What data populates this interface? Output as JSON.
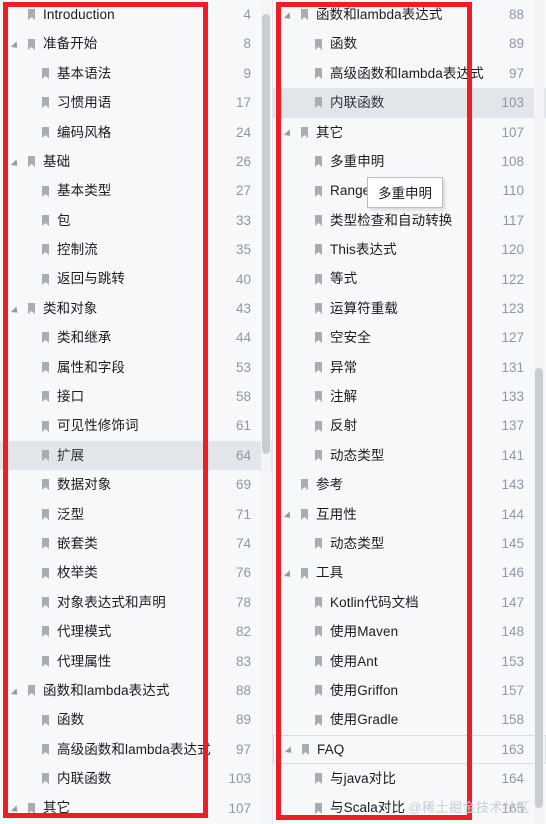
{
  "meta": {
    "watermark": "@稀土掘金技术社区",
    "accent_red": "#ee1c25",
    "selected_bg": "#e2e5ea",
    "page_number_color": "#8e96a8"
  },
  "tooltip": {
    "text": "多重申明"
  },
  "left_panel": {
    "items": [
      {
        "label": "Introduction",
        "page": "4",
        "level": 0,
        "expandable": false,
        "state": "normal"
      },
      {
        "label": "准备开始",
        "page": "8",
        "level": 0,
        "expandable": true,
        "state": "normal"
      },
      {
        "label": "基本语法",
        "page": "9",
        "level": 1,
        "expandable": false,
        "state": "normal"
      },
      {
        "label": "习惯用语",
        "page": "17",
        "level": 1,
        "expandable": false,
        "state": "normal"
      },
      {
        "label": "编码风格",
        "page": "24",
        "level": 1,
        "expandable": false,
        "state": "normal"
      },
      {
        "label": "基础",
        "page": "26",
        "level": 0,
        "expandable": true,
        "state": "normal"
      },
      {
        "label": "基本类型",
        "page": "27",
        "level": 1,
        "expandable": false,
        "state": "normal"
      },
      {
        "label": "包",
        "page": "33",
        "level": 1,
        "expandable": false,
        "state": "normal"
      },
      {
        "label": "控制流",
        "page": "35",
        "level": 1,
        "expandable": false,
        "state": "normal"
      },
      {
        "label": "返回与跳转",
        "page": "40",
        "level": 1,
        "expandable": false,
        "state": "normal"
      },
      {
        "label": "类和对象",
        "page": "43",
        "level": 0,
        "expandable": true,
        "state": "normal"
      },
      {
        "label": "类和继承",
        "page": "44",
        "level": 1,
        "expandable": false,
        "state": "normal"
      },
      {
        "label": "属性和字段",
        "page": "53",
        "level": 1,
        "expandable": false,
        "state": "normal"
      },
      {
        "label": "接口",
        "page": "58",
        "level": 1,
        "expandable": false,
        "state": "normal"
      },
      {
        "label": "可见性修饰词",
        "page": "61",
        "level": 1,
        "expandable": false,
        "state": "normal"
      },
      {
        "label": "扩展",
        "page": "64",
        "level": 1,
        "expandable": false,
        "state": "selected"
      },
      {
        "label": "数据对象",
        "page": "69",
        "level": 1,
        "expandable": false,
        "state": "normal"
      },
      {
        "label": "泛型",
        "page": "71",
        "level": 1,
        "expandable": false,
        "state": "normal"
      },
      {
        "label": "嵌套类",
        "page": "74",
        "level": 1,
        "expandable": false,
        "state": "normal"
      },
      {
        "label": "枚举类",
        "page": "76",
        "level": 1,
        "expandable": false,
        "state": "normal"
      },
      {
        "label": "对象表达式和声明",
        "page": "78",
        "level": 1,
        "expandable": false,
        "state": "normal"
      },
      {
        "label": "代理模式",
        "page": "82",
        "level": 1,
        "expandable": false,
        "state": "normal"
      },
      {
        "label": "代理属性",
        "page": "83",
        "level": 1,
        "expandable": false,
        "state": "normal"
      },
      {
        "label": "函数和lambda表达式",
        "page": "88",
        "level": 0,
        "expandable": true,
        "state": "normal"
      },
      {
        "label": "函数",
        "page": "89",
        "level": 1,
        "expandable": false,
        "state": "normal"
      },
      {
        "label": "高级函数和lambda表达式",
        "page": "97",
        "level": 1,
        "expandable": false,
        "state": "normal"
      },
      {
        "label": "内联函数",
        "page": "103",
        "level": 1,
        "expandable": false,
        "state": "normal"
      },
      {
        "label": "其它",
        "page": "107",
        "level": 0,
        "expandable": true,
        "state": "normal"
      }
    ]
  },
  "right_panel": {
    "items": [
      {
        "label": "函数和lambda表达式",
        "page": "88",
        "level": 0,
        "expandable": true,
        "state": "normal"
      },
      {
        "label": "函数",
        "page": "89",
        "level": 1,
        "expandable": false,
        "state": "normal"
      },
      {
        "label": "高级函数和lambda表达式",
        "page": "97",
        "level": 1,
        "expandable": false,
        "state": "normal"
      },
      {
        "label": "内联函数",
        "page": "103",
        "level": 1,
        "expandable": false,
        "state": "selected"
      },
      {
        "label": "其它",
        "page": "107",
        "level": 0,
        "expandable": true,
        "state": "normal"
      },
      {
        "label": "多重申明",
        "page": "108",
        "level": 1,
        "expandable": false,
        "state": "normal"
      },
      {
        "label": "Ranges",
        "page": "110",
        "level": 1,
        "expandable": false,
        "state": "normal"
      },
      {
        "label": "类型检查和自动转换",
        "page": "117",
        "level": 1,
        "expandable": false,
        "state": "normal"
      },
      {
        "label": "This表达式",
        "page": "120",
        "level": 1,
        "expandable": false,
        "state": "normal"
      },
      {
        "label": "等式",
        "page": "122",
        "level": 1,
        "expandable": false,
        "state": "normal"
      },
      {
        "label": "运算符重载",
        "page": "123",
        "level": 1,
        "expandable": false,
        "state": "normal"
      },
      {
        "label": "空安全",
        "page": "127",
        "level": 1,
        "expandable": false,
        "state": "normal"
      },
      {
        "label": "异常",
        "page": "131",
        "level": 1,
        "expandable": false,
        "state": "normal"
      },
      {
        "label": "注解",
        "page": "133",
        "level": 1,
        "expandable": false,
        "state": "normal"
      },
      {
        "label": "反射",
        "page": "137",
        "level": 1,
        "expandable": false,
        "state": "normal"
      },
      {
        "label": "动态类型",
        "page": "141",
        "level": 1,
        "expandable": false,
        "state": "normal"
      },
      {
        "label": "参考",
        "page": "143",
        "level": 0,
        "expandable": false,
        "state": "normal"
      },
      {
        "label": "互用性",
        "page": "144",
        "level": 0,
        "expandable": true,
        "state": "normal"
      },
      {
        "label": "动态类型",
        "page": "145",
        "level": 1,
        "expandable": false,
        "state": "normal"
      },
      {
        "label": "工具",
        "page": "146",
        "level": 0,
        "expandable": true,
        "state": "normal"
      },
      {
        "label": "Kotlin代码文档",
        "page": "147",
        "level": 1,
        "expandable": false,
        "state": "normal"
      },
      {
        "label": "使用Maven",
        "page": "148",
        "level": 1,
        "expandable": false,
        "state": "normal"
      },
      {
        "label": "使用Ant",
        "page": "153",
        "level": 1,
        "expandable": false,
        "state": "normal"
      },
      {
        "label": "使用Griffon",
        "page": "157",
        "level": 1,
        "expandable": false,
        "state": "normal"
      },
      {
        "label": "使用Gradle",
        "page": "158",
        "level": 1,
        "expandable": false,
        "state": "normal"
      },
      {
        "label": "FAQ",
        "page": "163",
        "level": 0,
        "expandable": true,
        "state": "hovered"
      },
      {
        "label": "与java对比",
        "page": "164",
        "level": 1,
        "expandable": false,
        "state": "normal"
      },
      {
        "label": "与Scala对比",
        "page": "165",
        "level": 1,
        "expandable": false,
        "state": "normal"
      }
    ]
  }
}
